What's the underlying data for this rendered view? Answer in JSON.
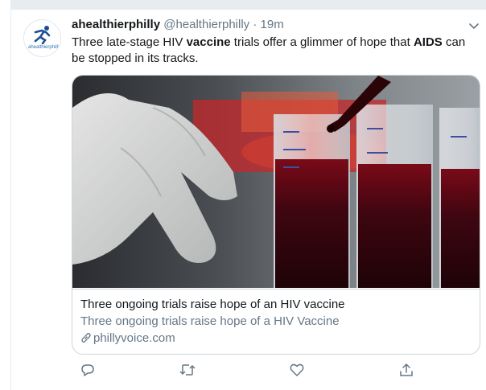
{
  "tweet": {
    "display_name": "ahealthierphilly",
    "handle": "@healthierphilly",
    "separator": "·",
    "time": "19m",
    "avatar_brand": "ahealthierphilly",
    "text_parts": [
      "Three late-stage HIV ",
      "vaccine",
      " trials offer a glimmer of hope that ",
      "AIDS",
      " can be stopped in its tracks."
    ]
  },
  "card": {
    "title": "Three ongoing trials raise hope of an HIV vaccine",
    "description": "Three ongoing trials raise hope of a HIV Vaccine",
    "domain": "phillyvoice.com",
    "image_alt": "Gloved hand holding test tubes with blood samples"
  },
  "icons": {
    "caret": "chevron-down-icon",
    "reply": "reply-icon",
    "retweet": "retweet-icon",
    "like": "heart-icon",
    "share": "share-icon",
    "link": "link-icon"
  },
  "colors": {
    "text": "#14171a",
    "secondary": "#657786",
    "border": "#ccd6dd",
    "divider": "#e6ecf0"
  }
}
